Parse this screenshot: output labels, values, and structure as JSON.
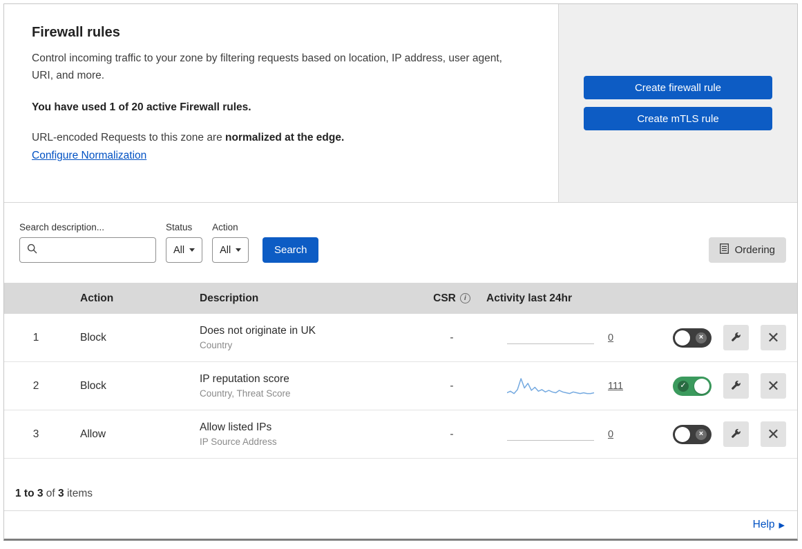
{
  "colors": {
    "blue": "#0d5cc4",
    "link": "#0051c3",
    "green": "#3b9a5d",
    "toggle_off": "#3d3d3d",
    "sparkline": "#74a9e0",
    "header_bg": "#d9d9d9",
    "panel_bg": "#efefef"
  },
  "intro": {
    "title": "Firewall rules",
    "description": "Control incoming traffic to your zone by filtering requests based on location, IP address, user agent, URI, and more.",
    "usage": "You have used 1 of 20 active Firewall rules.",
    "normalization_prefix": "URL-encoded Requests to this zone are ",
    "normalization_bold": "normalized at the edge.",
    "normalization_link": "Configure Normalization"
  },
  "panel": {
    "create_firewall_rule": "Create firewall rule",
    "create_mtls_rule": "Create mTLS rule"
  },
  "filters": {
    "search_label": "Search description...",
    "status_label": "Status",
    "status_value": "All",
    "action_label": "Action",
    "action_value": "All",
    "search_button": "Search",
    "ordering_button": "Ordering"
  },
  "table": {
    "headers": {
      "action": "Action",
      "description": "Description",
      "csr": "CSR",
      "activity": "Activity last 24hr"
    },
    "rows": [
      {
        "priority": "1",
        "action": "Block",
        "description": "Does not originate in UK",
        "criteria": "Country",
        "csr": "-",
        "count": "0",
        "enabled": false,
        "sparkline": []
      },
      {
        "priority": "2",
        "action": "Block",
        "description": "IP reputation score",
        "criteria": "Country, Threat Score",
        "csr": "-",
        "count": "111",
        "enabled": true,
        "sparkline": [
          4,
          6,
          3,
          8,
          22,
          10,
          16,
          7,
          11,
          6,
          8,
          5,
          7,
          5,
          4,
          7,
          5,
          4,
          3,
          5,
          4,
          3,
          4,
          3,
          3,
          4
        ]
      },
      {
        "priority": "3",
        "action": "Allow",
        "description": "Allow listed IPs",
        "criteria": "IP Source Address",
        "csr": "-",
        "count": "0",
        "enabled": false,
        "sparkline": []
      }
    ]
  },
  "footer": {
    "range": "1 to 3",
    "of": " of ",
    "total": "3",
    "items": " items",
    "help": "Help"
  }
}
